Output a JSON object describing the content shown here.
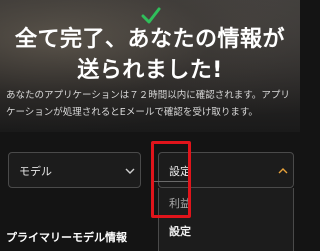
{
  "hero": {
    "headline": "全て完了、あなたの情報が\n送られました!",
    "description": "あなたのアプリケーションは７２時間以内に確認されます。アプリケーションが処理されるとEメールで確認を受け取ります。",
    "accent_color": "#2fbf5b"
  },
  "model_dropdown": {
    "selected": "モデル",
    "icon": "chevron-down-icon"
  },
  "category_dropdown": {
    "selected": "設定",
    "icon": "chevron-up-icon",
    "options": [
      "利益",
      "設定"
    ]
  },
  "section": {
    "title": "プライマリーモデル情報"
  },
  "annotation": {
    "highlight_color": "#e0141b"
  }
}
